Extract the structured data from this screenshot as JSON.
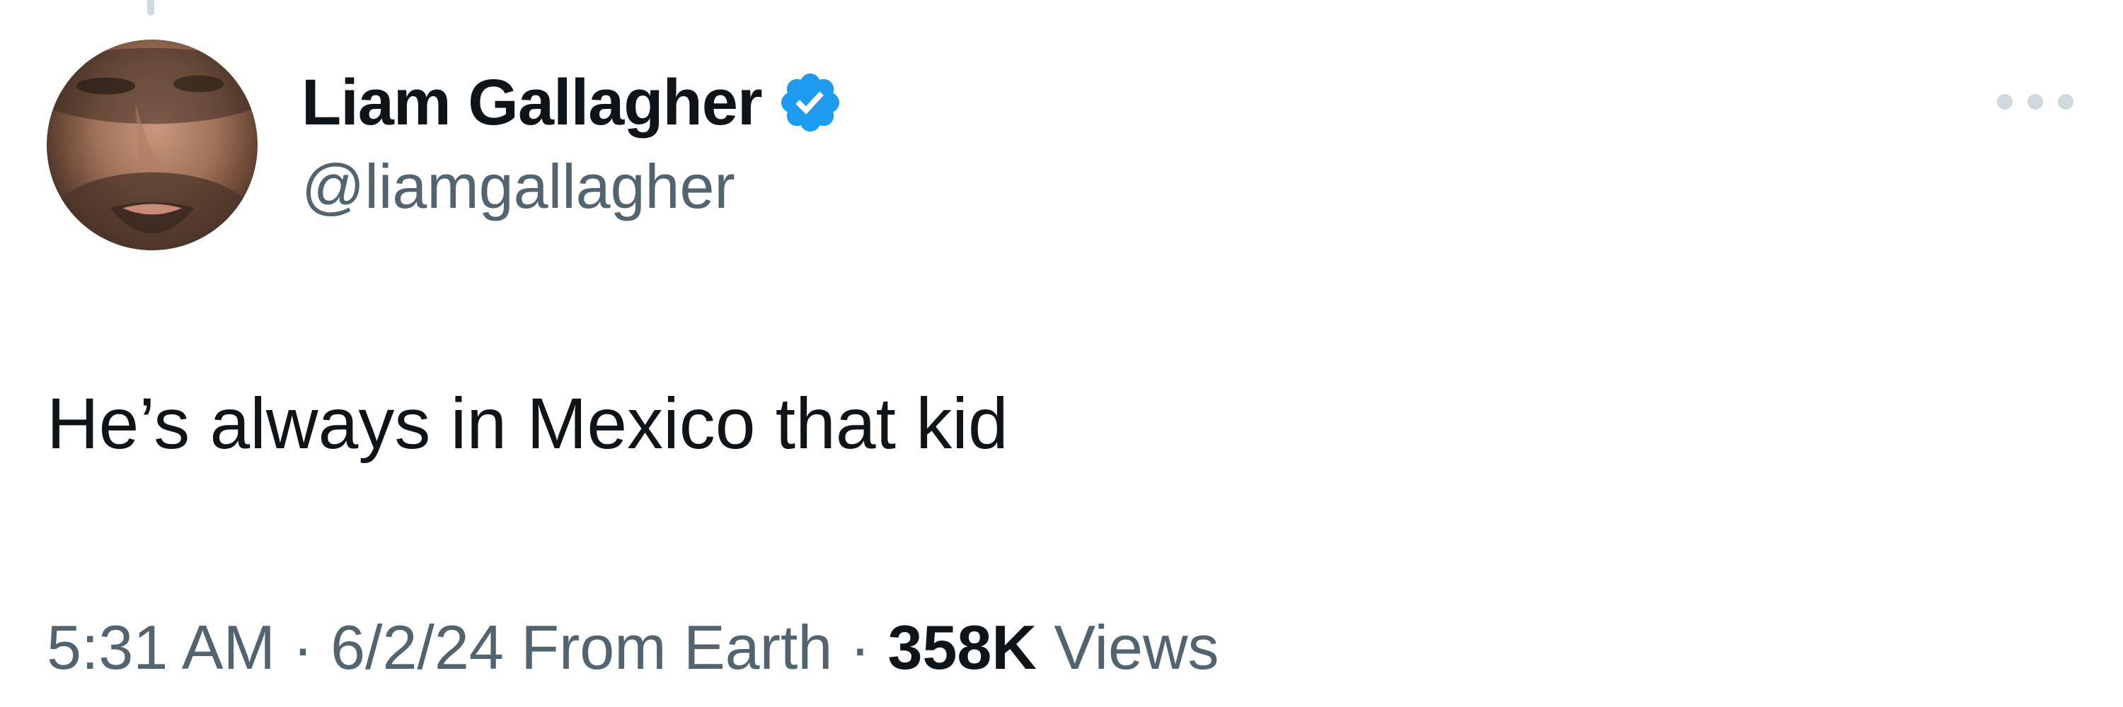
{
  "author": {
    "display_name": "Liam Gallagher",
    "handle": "@liamgallagher",
    "verified": true,
    "verified_color": "#1d9bf0"
  },
  "tweet": {
    "text": "He’s always in Mexico that kid"
  },
  "meta": {
    "time": "5:31 AM",
    "separator": "·",
    "date": "6/2/24",
    "source": "From Earth",
    "views_count": "358K",
    "views_label": "Views"
  },
  "icons": {
    "more": "more-horizontal-icon",
    "verified": "verified-badge-icon"
  },
  "colors": {
    "primary_text": "#0f1419",
    "secondary_text": "#536471",
    "muted_icon": "#cfd9de"
  }
}
